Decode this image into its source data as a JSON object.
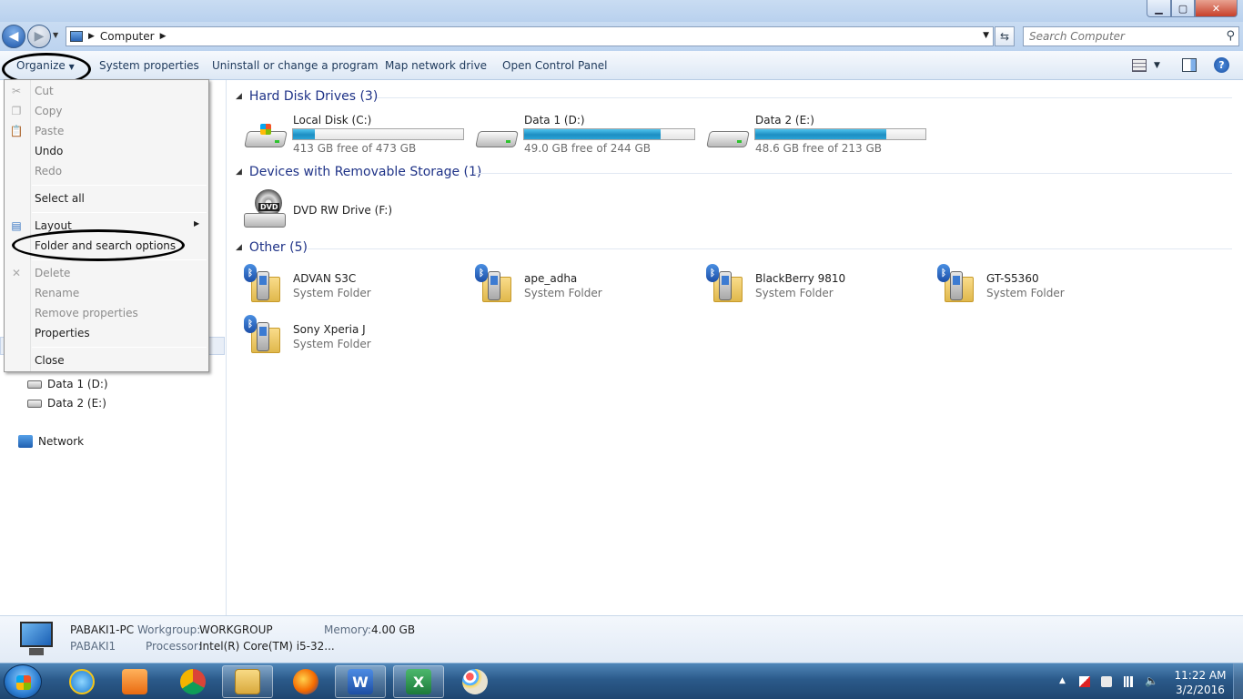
{
  "titlebar": {
    "title": "Computer"
  },
  "nav": {
    "address_crumb": "Computer",
    "search_placeholder": "Search Computer"
  },
  "cmdbar": {
    "organize": "Organize",
    "system_properties": "System properties",
    "uninstall": "Uninstall or change a program",
    "map_drive": "Map network drive",
    "control_panel": "Open Control Panel"
  },
  "menu": {
    "cut": "Cut",
    "copy": "Copy",
    "paste": "Paste",
    "undo": "Undo",
    "redo": "Redo",
    "select_all": "Select all",
    "layout": "Layout",
    "folder_options": "Folder and search options",
    "delete": "Delete",
    "rename": "Rename",
    "remove_properties": "Remove properties",
    "properties": "Properties",
    "close": "Close"
  },
  "navpane": {
    "data1": "Data 1 (D:)",
    "data2": "Data 2 (E:)",
    "network": "Network"
  },
  "groups": {
    "hdd_title": "Hard Disk Drives (3)",
    "removable_title": "Devices with Removable Storage (1)",
    "other_title": "Other (5)"
  },
  "drives": [
    {
      "name": "Local Disk (C:)",
      "free": "413 GB free of 473 GB",
      "used_fraction": 0.127
    },
    {
      "name": "Data 1 (D:)",
      "free": "49.0 GB free of 244 GB",
      "used_fraction": 0.8
    },
    {
      "name": "Data 2 (E:)",
      "free": "48.6 GB free of 213 GB",
      "used_fraction": 0.772
    }
  ],
  "removable": {
    "name": "DVD RW Drive (F:)",
    "icon_text": "DVD"
  },
  "other": [
    {
      "name": "ADVAN S3C",
      "type": "System Folder"
    },
    {
      "name": "ape_adha",
      "type": "System Folder"
    },
    {
      "name": "BlackBerry 9810",
      "type": "System Folder"
    },
    {
      "name": "GT-S5360",
      "type": "System Folder"
    },
    {
      "name": "Sony Xperia J",
      "type": "System Folder"
    }
  ],
  "details": {
    "pc_name": "PABAKI1-PC",
    "workgroup_label": "Workgroup:",
    "workgroup_value": "WORKGROUP",
    "memory_label": "Memory:",
    "memory_value": "4.00 GB",
    "user": "PABAKI1",
    "processor_label": "Processor:",
    "processor_value": "Intel(R) Core(TM) i5-32..."
  },
  "taskbar": {
    "time": "11:22 AM",
    "date": "3/2/2016",
    "apps": [
      "internet-explorer",
      "media-player",
      "chrome",
      "windows-explorer",
      "firefox",
      "word",
      "excel",
      "paint"
    ]
  },
  "colors": {
    "accent_blue": "#1e3287",
    "drive_fill": "#1d8ec2",
    "taskbar": "#2b5a8a"
  }
}
